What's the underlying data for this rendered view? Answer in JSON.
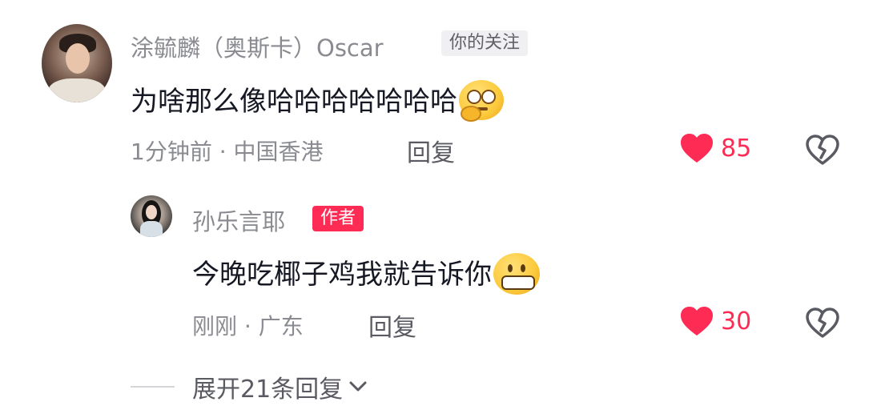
{
  "comment": {
    "username": "涂毓麟（奥斯卡）Oscar",
    "badge": "你的关注",
    "text": "为啥那么像哈哈哈哈哈哈哈",
    "meta": "1分钟前 · 中国香港",
    "reply_label": "回复",
    "likes": "85",
    "emoji": "thinking-face"
  },
  "reply": {
    "username": "孙乐言耶",
    "badge": "作者",
    "text": "今晚吃椰子鸡我就告诉你",
    "meta": "刚刚 · 广东",
    "reply_label": "回复",
    "likes": "30",
    "emoji": "grinning-face"
  },
  "expand": {
    "label": "展开21条回复"
  },
  "colors": {
    "accent": "#fe2c55",
    "text_primary": "#161823",
    "text_secondary": "#8a8b91"
  }
}
